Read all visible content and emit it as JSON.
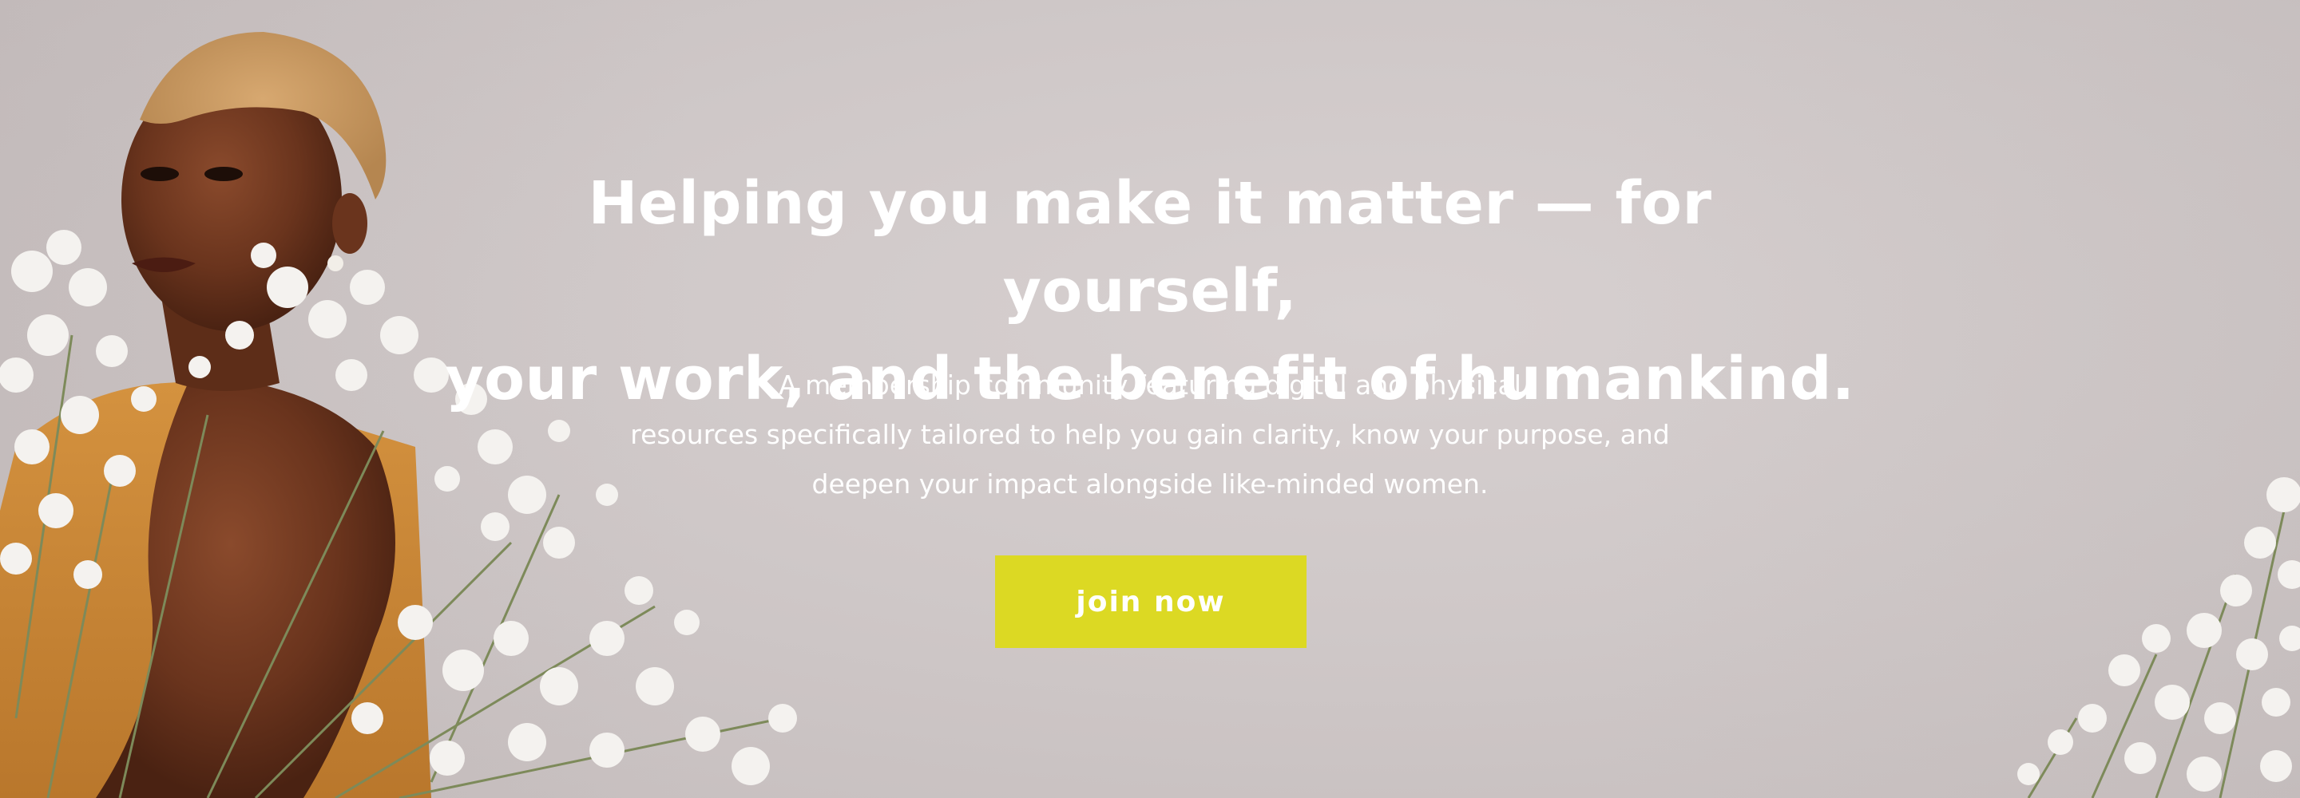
{
  "hero": {
    "headline_line1": "Helping you make it matter — for yourself,",
    "headline_line2": "your work, and the benefit of humankind.",
    "subtext_line1": "A membership community featuring digital and physical",
    "subtext_line2": "resources specifically tailored to help you gain clarity, know your purpose, and",
    "subtext_line3": "deepen your impact alongside like-minded women.",
    "cta_label": "join now",
    "background_color": "#cdc6c6",
    "cta_color": "#dcd923",
    "image": "woman-with-babys-breath-flowers"
  }
}
